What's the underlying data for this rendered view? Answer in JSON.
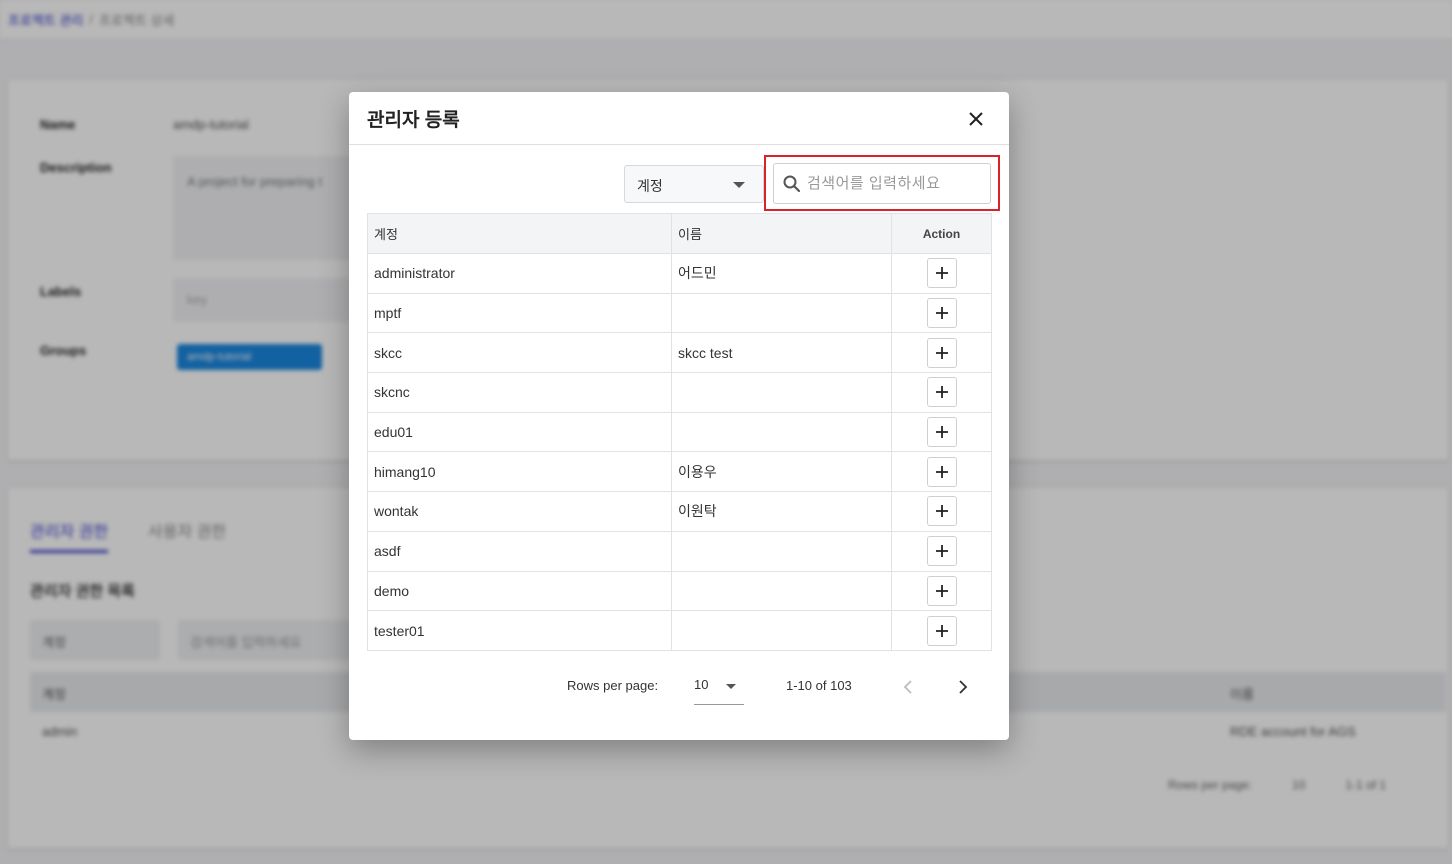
{
  "background": {
    "breadcrumb": [
      "프로젝트 관리",
      "/",
      "프로젝트 상세"
    ],
    "fields": {
      "name_label": "Name",
      "name_value": "amdp-tutorial",
      "description_label": "Description",
      "description_value": "A project for preparing t",
      "labels_label": "Labels",
      "labels_placeholder": "key",
      "groups_label": "Groups",
      "group_chip": "amdp-tutorial"
    },
    "tabs": [
      "관리자 권한",
      "사용자 권한"
    ],
    "list_title": "관리자 권한 목록",
    "select_value": "계정",
    "search_placeholder": "검색어를 입력하세요",
    "table_header": [
      "계정",
      "이름"
    ],
    "table_row": [
      "admin",
      "RDE account for AGS"
    ],
    "pager": {
      "rows_label": "Rows per page:",
      "rows_value": "10",
      "range": "1-1 of 1"
    }
  },
  "modal": {
    "title": "관리자 등록",
    "filter_select": "계정",
    "search_placeholder": "검색어를 입력하세요",
    "columns": {
      "account": "계정",
      "name": "이름",
      "action": "Action"
    },
    "rows": [
      {
        "account": "administrator",
        "name": "어드민"
      },
      {
        "account": "mptf",
        "name": ""
      },
      {
        "account": "skcc",
        "name": "skcc test"
      },
      {
        "account": "skcnc",
        "name": ""
      },
      {
        "account": "edu01",
        "name": ""
      },
      {
        "account": "himang10",
        "name": "이용우"
      },
      {
        "account": "wontak",
        "name": "이원탁"
      },
      {
        "account": "asdf",
        "name": ""
      },
      {
        "account": "demo",
        "name": ""
      },
      {
        "account": "tester01",
        "name": ""
      }
    ],
    "pagination": {
      "rows_label": "Rows per page:",
      "rows_value": "10",
      "range": "1-10 of 103"
    }
  },
  "colors": {
    "highlight": "#d8232a",
    "link": "#3b3fd1",
    "chip": "#1a87e0"
  }
}
